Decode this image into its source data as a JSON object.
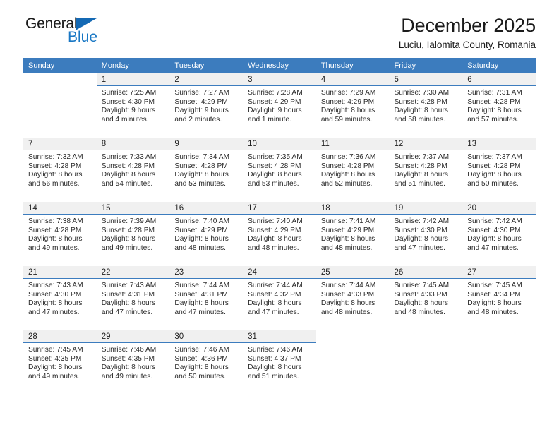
{
  "logo": {
    "text_top": "General",
    "text_bottom": "Blue",
    "triangle_color": "#1469b4",
    "blue_color": "#1877c4"
  },
  "header": {
    "title": "December 2025",
    "subtitle": "Luciu, Ialomita County, Romania"
  },
  "theme": {
    "header_row_bg": "#3c7cbe",
    "header_row_text": "#ffffff",
    "daynum_band_bg": "#f0f0f0",
    "accent_rule": "#3c7cbe"
  },
  "weekdays": [
    "Sunday",
    "Monday",
    "Tuesday",
    "Wednesday",
    "Thursday",
    "Friday",
    "Saturday"
  ],
  "weeks": [
    [
      {
        "day": "",
        "sunrise": "",
        "sunset": "",
        "daylight1": "",
        "daylight2": ""
      },
      {
        "day": "1",
        "sunrise": "Sunrise: 7:25 AM",
        "sunset": "Sunset: 4:30 PM",
        "daylight1": "Daylight: 9 hours",
        "daylight2": "and 4 minutes."
      },
      {
        "day": "2",
        "sunrise": "Sunrise: 7:27 AM",
        "sunset": "Sunset: 4:29 PM",
        "daylight1": "Daylight: 9 hours",
        "daylight2": "and 2 minutes."
      },
      {
        "day": "3",
        "sunrise": "Sunrise: 7:28 AM",
        "sunset": "Sunset: 4:29 PM",
        "daylight1": "Daylight: 9 hours",
        "daylight2": "and 1 minute."
      },
      {
        "day": "4",
        "sunrise": "Sunrise: 7:29 AM",
        "sunset": "Sunset: 4:29 PM",
        "daylight1": "Daylight: 8 hours",
        "daylight2": "and 59 minutes."
      },
      {
        "day": "5",
        "sunrise": "Sunrise: 7:30 AM",
        "sunset": "Sunset: 4:28 PM",
        "daylight1": "Daylight: 8 hours",
        "daylight2": "and 58 minutes."
      },
      {
        "day": "6",
        "sunrise": "Sunrise: 7:31 AM",
        "sunset": "Sunset: 4:28 PM",
        "daylight1": "Daylight: 8 hours",
        "daylight2": "and 57 minutes."
      }
    ],
    [
      {
        "day": "7",
        "sunrise": "Sunrise: 7:32 AM",
        "sunset": "Sunset: 4:28 PM",
        "daylight1": "Daylight: 8 hours",
        "daylight2": "and 56 minutes."
      },
      {
        "day": "8",
        "sunrise": "Sunrise: 7:33 AM",
        "sunset": "Sunset: 4:28 PM",
        "daylight1": "Daylight: 8 hours",
        "daylight2": "and 54 minutes."
      },
      {
        "day": "9",
        "sunrise": "Sunrise: 7:34 AM",
        "sunset": "Sunset: 4:28 PM",
        "daylight1": "Daylight: 8 hours",
        "daylight2": "and 53 minutes."
      },
      {
        "day": "10",
        "sunrise": "Sunrise: 7:35 AM",
        "sunset": "Sunset: 4:28 PM",
        "daylight1": "Daylight: 8 hours",
        "daylight2": "and 53 minutes."
      },
      {
        "day": "11",
        "sunrise": "Sunrise: 7:36 AM",
        "sunset": "Sunset: 4:28 PM",
        "daylight1": "Daylight: 8 hours",
        "daylight2": "and 52 minutes."
      },
      {
        "day": "12",
        "sunrise": "Sunrise: 7:37 AM",
        "sunset": "Sunset: 4:28 PM",
        "daylight1": "Daylight: 8 hours",
        "daylight2": "and 51 minutes."
      },
      {
        "day": "13",
        "sunrise": "Sunrise: 7:37 AM",
        "sunset": "Sunset: 4:28 PM",
        "daylight1": "Daylight: 8 hours",
        "daylight2": "and 50 minutes."
      }
    ],
    [
      {
        "day": "14",
        "sunrise": "Sunrise: 7:38 AM",
        "sunset": "Sunset: 4:28 PM",
        "daylight1": "Daylight: 8 hours",
        "daylight2": "and 49 minutes."
      },
      {
        "day": "15",
        "sunrise": "Sunrise: 7:39 AM",
        "sunset": "Sunset: 4:28 PM",
        "daylight1": "Daylight: 8 hours",
        "daylight2": "and 49 minutes."
      },
      {
        "day": "16",
        "sunrise": "Sunrise: 7:40 AM",
        "sunset": "Sunset: 4:29 PM",
        "daylight1": "Daylight: 8 hours",
        "daylight2": "and 48 minutes."
      },
      {
        "day": "17",
        "sunrise": "Sunrise: 7:40 AM",
        "sunset": "Sunset: 4:29 PM",
        "daylight1": "Daylight: 8 hours",
        "daylight2": "and 48 minutes."
      },
      {
        "day": "18",
        "sunrise": "Sunrise: 7:41 AM",
        "sunset": "Sunset: 4:29 PM",
        "daylight1": "Daylight: 8 hours",
        "daylight2": "and 48 minutes."
      },
      {
        "day": "19",
        "sunrise": "Sunrise: 7:42 AM",
        "sunset": "Sunset: 4:30 PM",
        "daylight1": "Daylight: 8 hours",
        "daylight2": "and 47 minutes."
      },
      {
        "day": "20",
        "sunrise": "Sunrise: 7:42 AM",
        "sunset": "Sunset: 4:30 PM",
        "daylight1": "Daylight: 8 hours",
        "daylight2": "and 47 minutes."
      }
    ],
    [
      {
        "day": "21",
        "sunrise": "Sunrise: 7:43 AM",
        "sunset": "Sunset: 4:30 PM",
        "daylight1": "Daylight: 8 hours",
        "daylight2": "and 47 minutes."
      },
      {
        "day": "22",
        "sunrise": "Sunrise: 7:43 AM",
        "sunset": "Sunset: 4:31 PM",
        "daylight1": "Daylight: 8 hours",
        "daylight2": "and 47 minutes."
      },
      {
        "day": "23",
        "sunrise": "Sunrise: 7:44 AM",
        "sunset": "Sunset: 4:31 PM",
        "daylight1": "Daylight: 8 hours",
        "daylight2": "and 47 minutes."
      },
      {
        "day": "24",
        "sunrise": "Sunrise: 7:44 AM",
        "sunset": "Sunset: 4:32 PM",
        "daylight1": "Daylight: 8 hours",
        "daylight2": "and 47 minutes."
      },
      {
        "day": "25",
        "sunrise": "Sunrise: 7:44 AM",
        "sunset": "Sunset: 4:33 PM",
        "daylight1": "Daylight: 8 hours",
        "daylight2": "and 48 minutes."
      },
      {
        "day": "26",
        "sunrise": "Sunrise: 7:45 AM",
        "sunset": "Sunset: 4:33 PM",
        "daylight1": "Daylight: 8 hours",
        "daylight2": "and 48 minutes."
      },
      {
        "day": "27",
        "sunrise": "Sunrise: 7:45 AM",
        "sunset": "Sunset: 4:34 PM",
        "daylight1": "Daylight: 8 hours",
        "daylight2": "and 48 minutes."
      }
    ],
    [
      {
        "day": "28",
        "sunrise": "Sunrise: 7:45 AM",
        "sunset": "Sunset: 4:35 PM",
        "daylight1": "Daylight: 8 hours",
        "daylight2": "and 49 minutes."
      },
      {
        "day": "29",
        "sunrise": "Sunrise: 7:46 AM",
        "sunset": "Sunset: 4:35 PM",
        "daylight1": "Daylight: 8 hours",
        "daylight2": "and 49 minutes."
      },
      {
        "day": "30",
        "sunrise": "Sunrise: 7:46 AM",
        "sunset": "Sunset: 4:36 PM",
        "daylight1": "Daylight: 8 hours",
        "daylight2": "and 50 minutes."
      },
      {
        "day": "31",
        "sunrise": "Sunrise: 7:46 AM",
        "sunset": "Sunset: 4:37 PM",
        "daylight1": "Daylight: 8 hours",
        "daylight2": "and 51 minutes."
      },
      {
        "day": "",
        "sunrise": "",
        "sunset": "",
        "daylight1": "",
        "daylight2": ""
      },
      {
        "day": "",
        "sunrise": "",
        "sunset": "",
        "daylight1": "",
        "daylight2": ""
      },
      {
        "day": "",
        "sunrise": "",
        "sunset": "",
        "daylight1": "",
        "daylight2": ""
      }
    ]
  ]
}
